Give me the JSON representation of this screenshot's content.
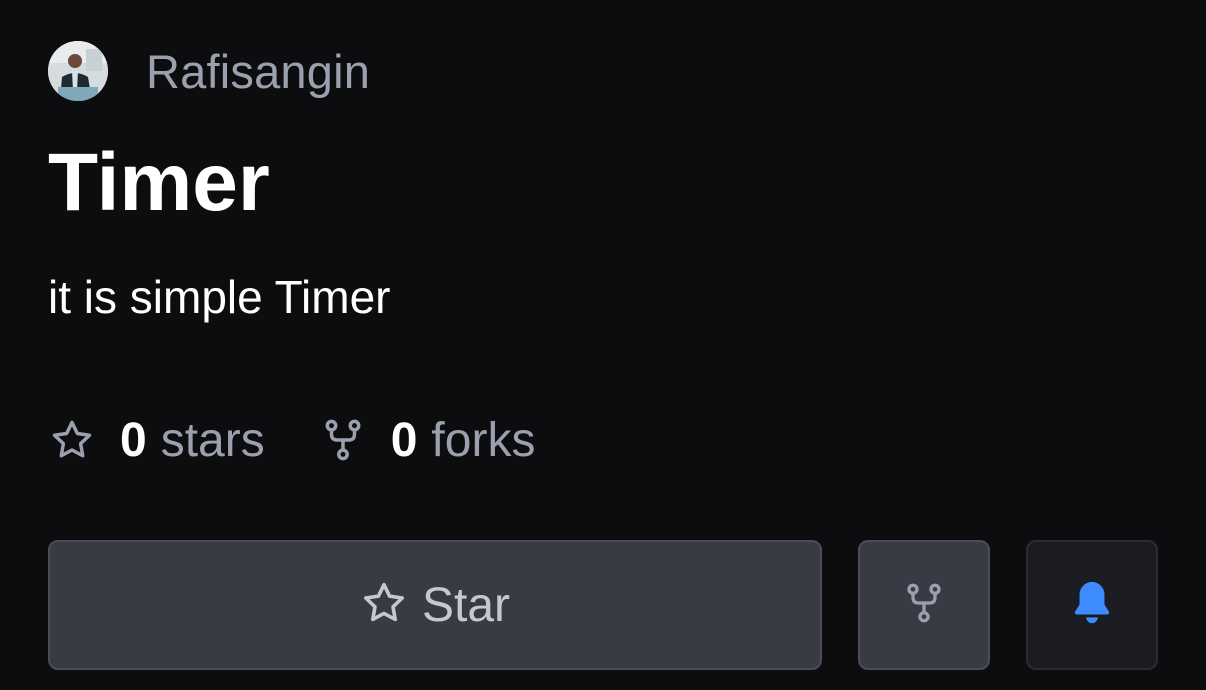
{
  "owner": {
    "name": "Rafisangin",
    "avatar_icon": "user-avatar"
  },
  "repo": {
    "title": "Timer",
    "description": "it is simple Timer"
  },
  "stats": {
    "stars_count": "0",
    "stars_label": "stars",
    "stars_icon": "star-outline-icon",
    "forks_count": "0",
    "forks_label": "forks",
    "forks_icon": "fork-icon"
  },
  "actions": {
    "star_label": "Star",
    "star_icon": "star-outline-icon",
    "fork_icon": "fork-icon",
    "watch_icon": "bell-icon"
  },
  "colors": {
    "background": "#0d0d10",
    "muted_text": "#9aa0ad",
    "button_bg": "#393b44",
    "accent_bell": "#3d8bfd"
  }
}
